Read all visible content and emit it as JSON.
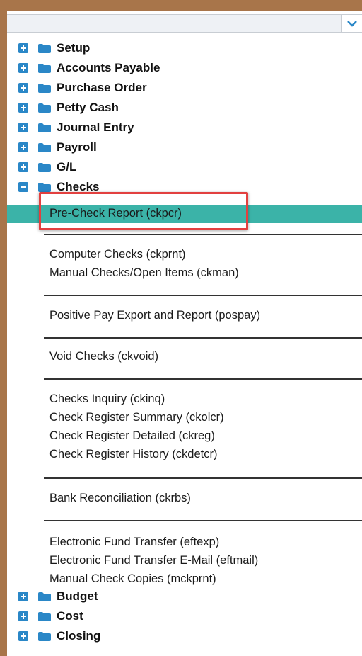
{
  "dropdown": {
    "value": "",
    "arrow_icon": "chevron-down-icon"
  },
  "tree_top": [
    {
      "label": "Setup",
      "state": "collapsed"
    },
    {
      "label": "Accounts Payable",
      "state": "collapsed"
    },
    {
      "label": "Purchase Order",
      "state": "collapsed"
    },
    {
      "label": "Petty Cash",
      "state": "collapsed"
    },
    {
      "label": "Journal Entry",
      "state": "collapsed"
    },
    {
      "label": "Payroll",
      "state": "collapsed"
    },
    {
      "label": "G/L",
      "state": "collapsed"
    },
    {
      "label": "Checks",
      "state": "expanded"
    }
  ],
  "checks_items": {
    "pre_check": "Pre-Check Report (ckpcr)",
    "computer_checks": "Computer Checks (ckprnt)",
    "manual_checks": "Manual Checks/Open Items (ckman)",
    "positive_pay": "Positive Pay Export and Report (pospay)",
    "void_checks": "Void Checks (ckvoid)",
    "checks_inquiry": "Checks Inquiry (ckinq)",
    "register_summary": "Check Register Summary (ckolcr)",
    "register_detailed": "Check Register Detailed (ckreg)",
    "register_history": "Check Register History (ckdetcr)",
    "bank_recon": "Bank Reconciliation (ckrbs)",
    "eft": "Electronic Fund Transfer (eftexp)",
    "eft_email": "Electronic Fund Transfer E-Mail (eftmail)",
    "manual_copies": "Manual Check Copies (mckprnt)"
  },
  "tree_bottom": [
    {
      "label": "Budget",
      "state": "collapsed"
    },
    {
      "label": "Cost",
      "state": "collapsed"
    },
    {
      "label": "Closing",
      "state": "collapsed"
    }
  ],
  "colors": {
    "frame": "#a8754a",
    "expander": "#2a87c7",
    "folder": "#2a87c7",
    "selected_row": "#3bb3a8",
    "highlight_box": "#e2403f"
  }
}
